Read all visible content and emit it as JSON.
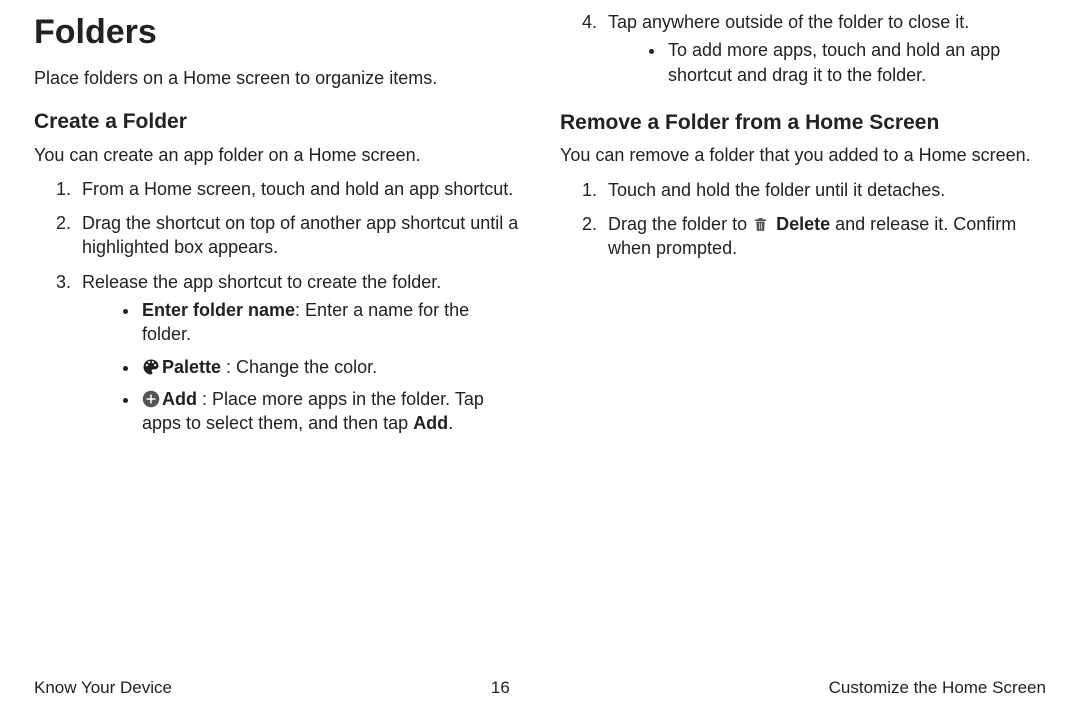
{
  "title": "Folders",
  "intro": "Place folders on a Home screen to organize items.",
  "create": {
    "heading": "Create a Folder",
    "lead": "You can create an app folder on a Home screen.",
    "step1": "From a Home screen, touch and hold an app shortcut.",
    "step2": "Drag the shortcut on top of another app shortcut until a highlighted box appears.",
    "step3": "Release the app shortcut to create the folder.",
    "bullet1_label": "Enter folder name",
    "bullet1_rest": ": Enter a name for the folder.",
    "bullet2_label": "Palette",
    "bullet2_rest": " : Change the color.",
    "bullet3_label": "Add",
    "bullet3_rest_a": " : Place more apps in the folder. Tap apps to select them, and then tap ",
    "bullet3_rest_b": "Add",
    "bullet3_rest_c": "."
  },
  "col2": {
    "step4": "Tap anywhere outside of the folder to close it.",
    "step4_bullet": "To add more apps, touch and hold an app shortcut and drag it to the folder."
  },
  "remove": {
    "heading": "Remove a Folder from a Home Screen",
    "lead": "You can remove a folder that you added to a Home screen.",
    "step1": "Touch and hold the folder until it detaches.",
    "step2_a": "Drag the folder to ",
    "step2_label": "Delete",
    "step2_b": " and release it. Confirm when prompted."
  },
  "footer": {
    "left": "Know Your Device",
    "center": "16",
    "right": "Customize the Home Screen"
  }
}
